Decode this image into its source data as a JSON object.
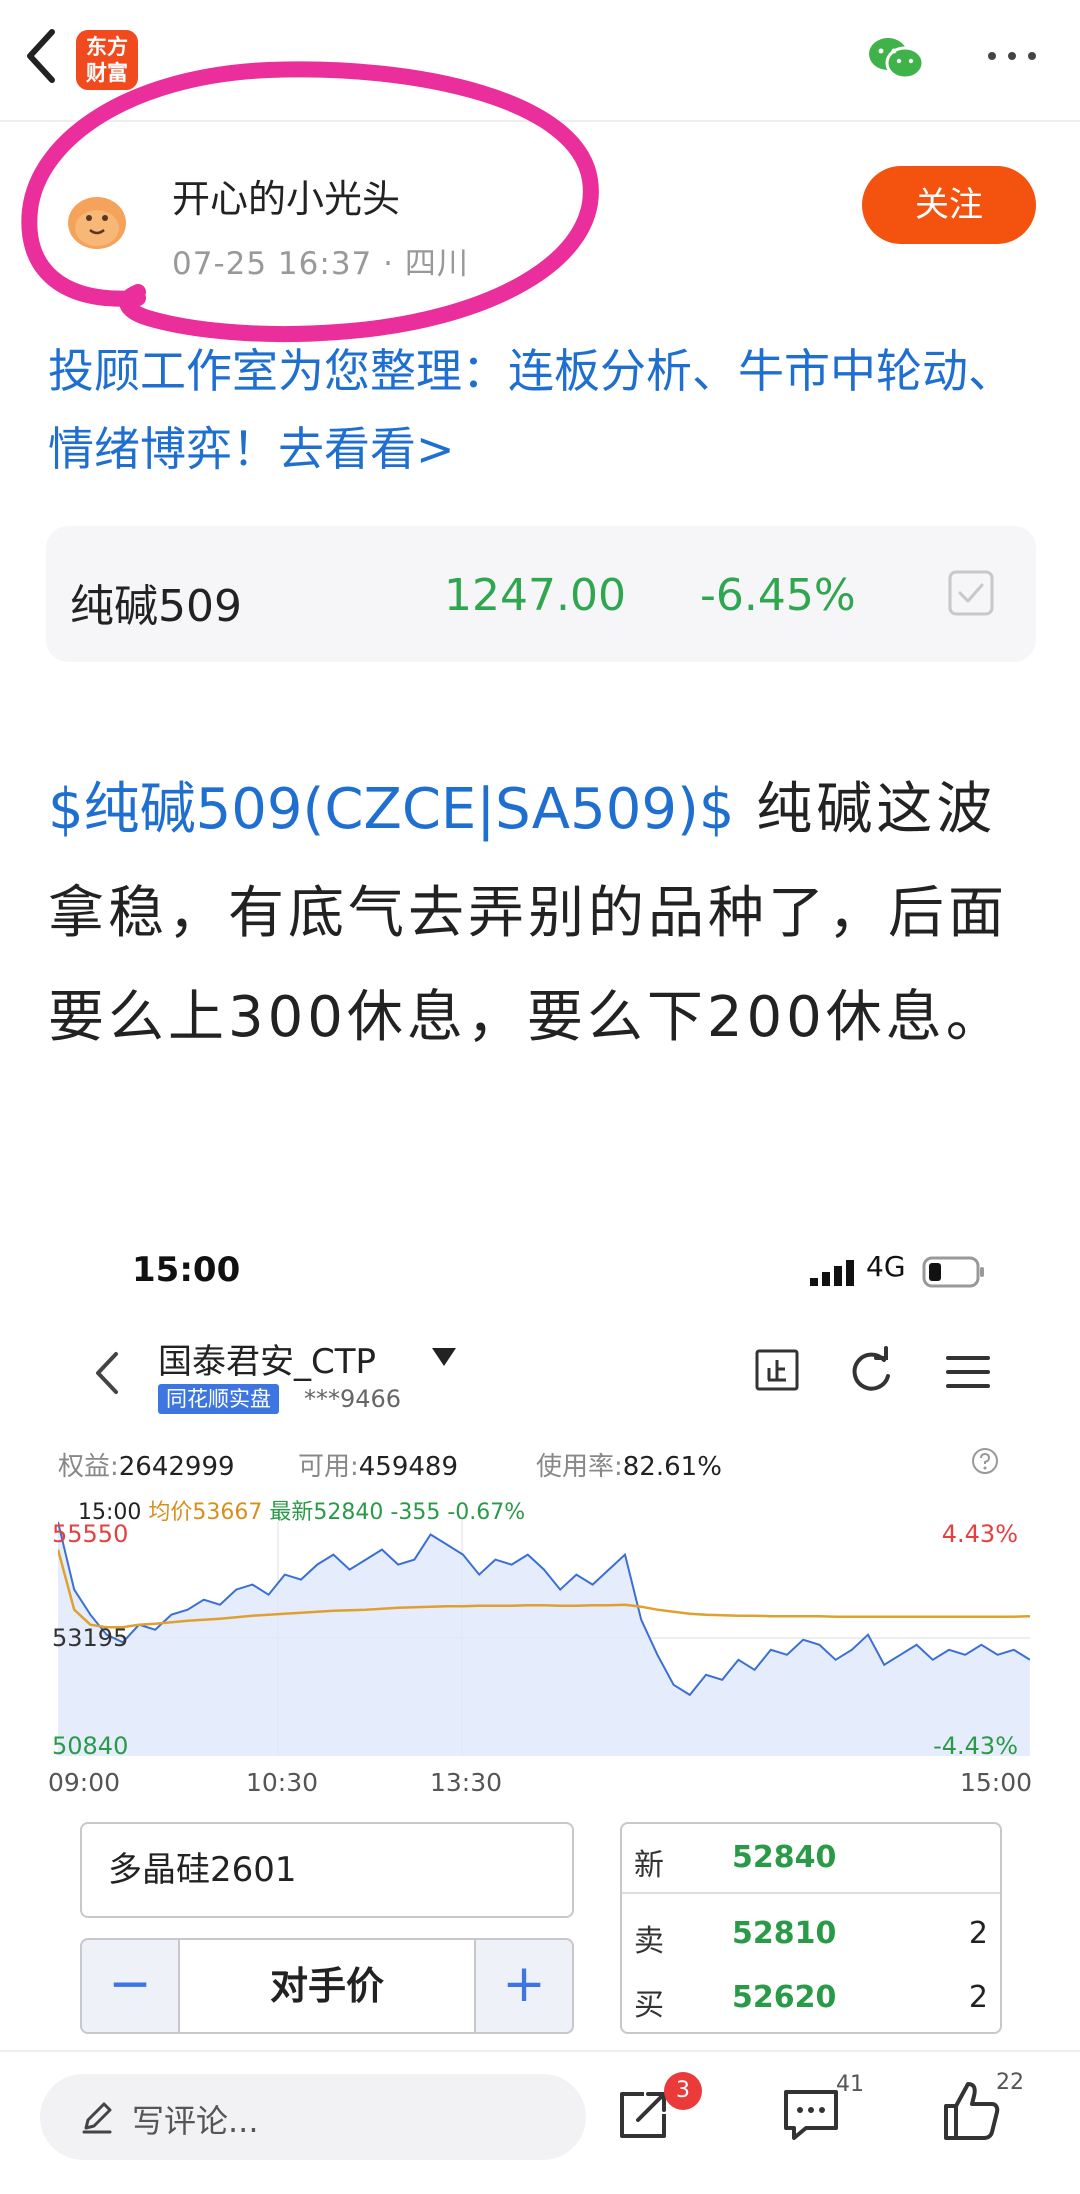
{
  "header": {
    "logo_line1": "东方",
    "logo_line2": "财富",
    "icons": [
      "back-icon",
      "wechat-icon",
      "more-icon"
    ]
  },
  "post": {
    "author": "开心的小光头",
    "datetime": "07-25 16:37",
    "location": "四川",
    "follow_label": "关注",
    "promo_text": "投顾工作室为您整理：连板分析、牛市中轮动、情绪博弈！去看看>",
    "stock_card": {
      "name": "纯碱509",
      "price": "1247.00",
      "change": "-6.45%"
    },
    "body_tag": "$纯碱509(CZCE|SA509)$",
    "body_text": "纯碱这波拿稳，有底气去弄别的品种了，后面要么上300休息，要么下200休息。"
  },
  "embedded_screenshot": {
    "status_time": "15:00",
    "network": "4G",
    "account": "国泰君安_CTP",
    "badge": "同花顺实盘",
    "account_masked": "***9466",
    "stats": [
      {
        "label": "权益:",
        "value": "2642999"
      },
      {
        "label": "可用:",
        "value": "459489"
      },
      {
        "label": "使用率:",
        "value": "82.61%"
      }
    ],
    "legend": {
      "time": "15:00",
      "avg": "均价53667",
      "last": "最新52840",
      "diff": "-355",
      "pct": "-0.67%"
    },
    "symbol": "多晶硅2601",
    "price_mode": "对手价",
    "minus": "−",
    "plus": "+",
    "quote": [
      {
        "label": "新",
        "value": "52840",
        "volume": ""
      },
      {
        "label": "卖",
        "value": "52810",
        "volume": "2"
      },
      {
        "label": "买",
        "value": "52620",
        "volume": "2"
      }
    ]
  },
  "chart_data": {
    "type": "line",
    "x_ticks": [
      "09:00",
      "10:30",
      "13:30",
      "15:00"
    ],
    "y_labels": {
      "top": "55550",
      "mid": "53195",
      "bottom": "50840"
    },
    "right_labels": {
      "top": "4.43%",
      "bottom": "-4.43%"
    },
    "ylim": [
      50840,
      55550
    ],
    "series": [
      {
        "color": "#3b6fd6",
        "values": [
          55550,
          54200,
          53700,
          53300,
          53150,
          53500,
          53400,
          53700,
          53800,
          54000,
          53900,
          54200,
          54300,
          54100,
          54500,
          54400,
          54700,
          54900,
          54600,
          54800,
          55000,
          54700,
          54800,
          55300,
          55100,
          54900,
          54500,
          54800,
          54700,
          54900,
          54600,
          54200,
          54500,
          54300,
          54600,
          54900,
          53600,
          52900,
          52300,
          52100,
          52500,
          52400,
          52800,
          52600,
          53000,
          52900,
          53200,
          53100,
          52800,
          53000,
          53300,
          52700,
          52900,
          53100,
          52800,
          53000,
          52900,
          53100,
          52900,
          53000,
          52800
        ]
      },
      {
        "color": "#e0a030",
        "values": [
          55000,
          53800,
          53500,
          53450,
          53450,
          53500,
          53520,
          53550,
          53580,
          53600,
          53620,
          53650,
          53680,
          53700,
          53720,
          53740,
          53760,
          53780,
          53790,
          53800,
          53820,
          53840,
          53850,
          53860,
          53870,
          53870,
          53880,
          53880,
          53880,
          53890,
          53890,
          53880,
          53880,
          53890,
          53890,
          53900,
          53860,
          53800,
          53760,
          53720,
          53700,
          53690,
          53680,
          53680,
          53670,
          53670,
          53670,
          53670,
          53660,
          53660,
          53660,
          53660,
          53660,
          53660,
          53660,
          53660,
          53660,
          53660,
          53660,
          53660,
          53667
        ]
      }
    ]
  },
  "bottom_bar": {
    "comment_placeholder": "写评论...",
    "share_count": "3",
    "comment_count": "41",
    "like_count": "22"
  },
  "colors": {
    "brand": "#f04a1e",
    "follow": "#f3520f",
    "link": "#1f6fd1",
    "down": "#2fa64f",
    "annotation": "#ea2e9c"
  }
}
